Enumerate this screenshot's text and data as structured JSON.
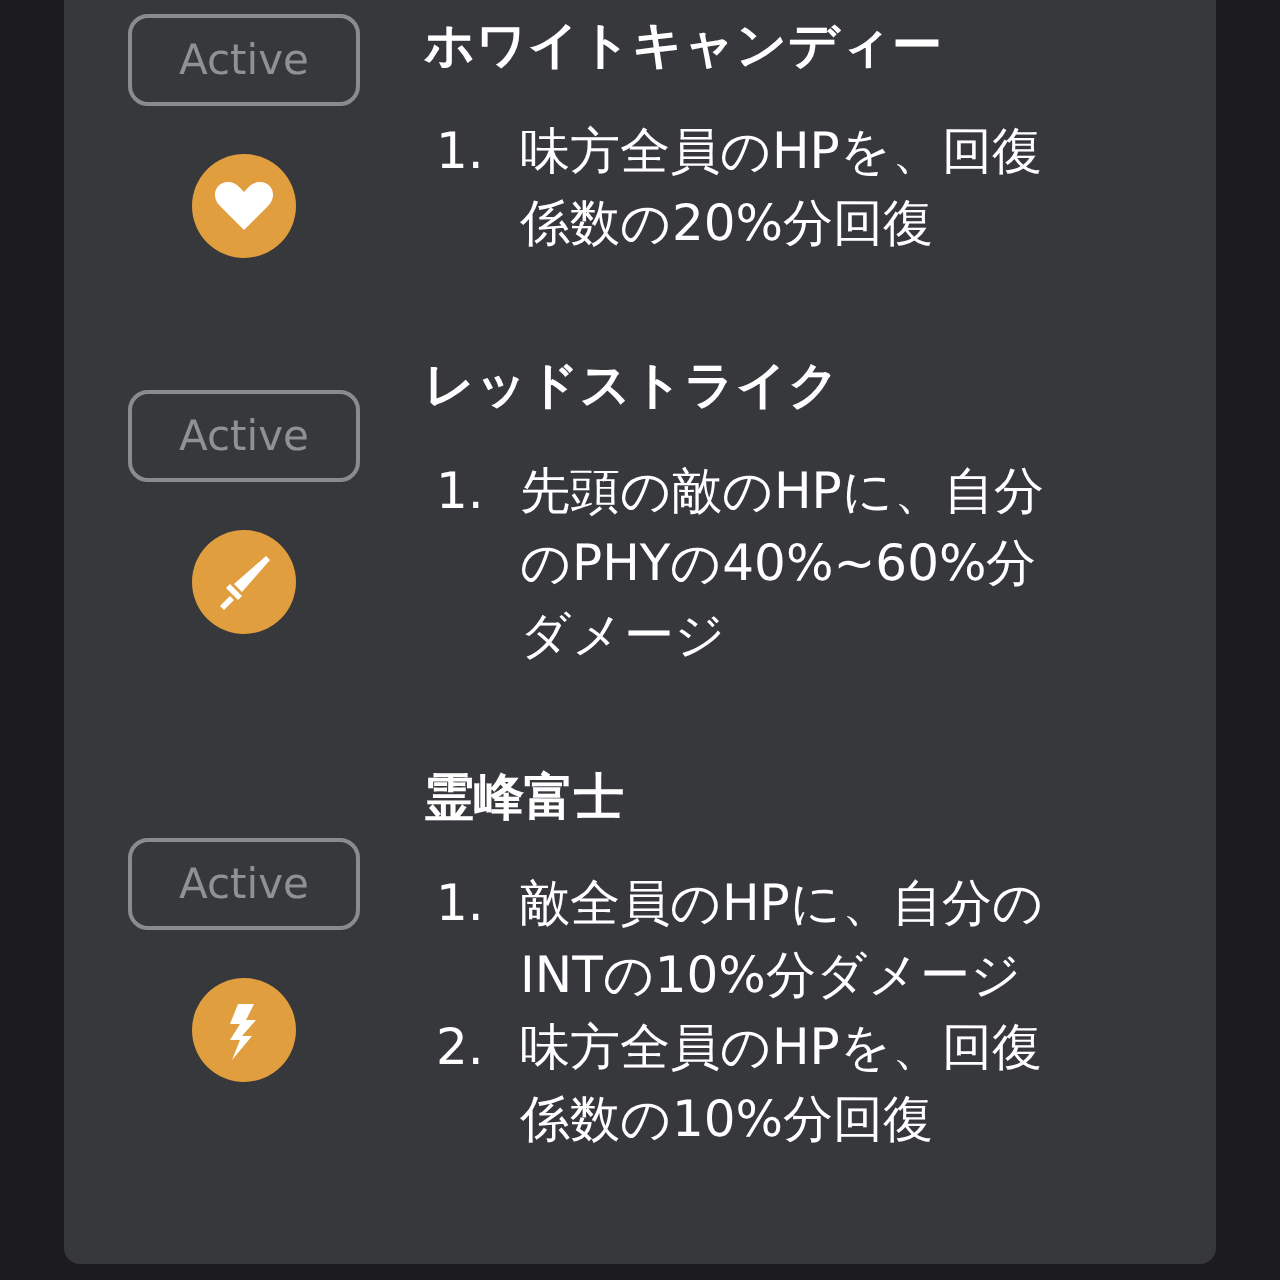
{
  "skills": [
    {
      "badge": "Active",
      "kind": "heart",
      "title": "ホワイトキャンディー",
      "effects": [
        {
          "number": "1.",
          "lines": [
            "味方全員のHPを、回復",
            "係数の20%分回復"
          ]
        }
      ]
    },
    {
      "badge": "Active",
      "kind": "sword",
      "title": "レッドストライク",
      "effects": [
        {
          "number": "1.",
          "lines": [
            "先頭の敵のHPに、自分",
            "のPHYの40%~60%分",
            "ダメージ"
          ]
        }
      ]
    },
    {
      "badge": "Active",
      "kind": "bolt",
      "title": "霊峰富士",
      "effects": [
        {
          "number": "1.",
          "lines": [
            "敵全員のHPに、自分の",
            "INTの10%分ダメージ"
          ]
        },
        {
          "number": "2.",
          "lines": [
            "味方全員のHPを、回復",
            "係数の10%分回復"
          ]
        }
      ]
    }
  ]
}
